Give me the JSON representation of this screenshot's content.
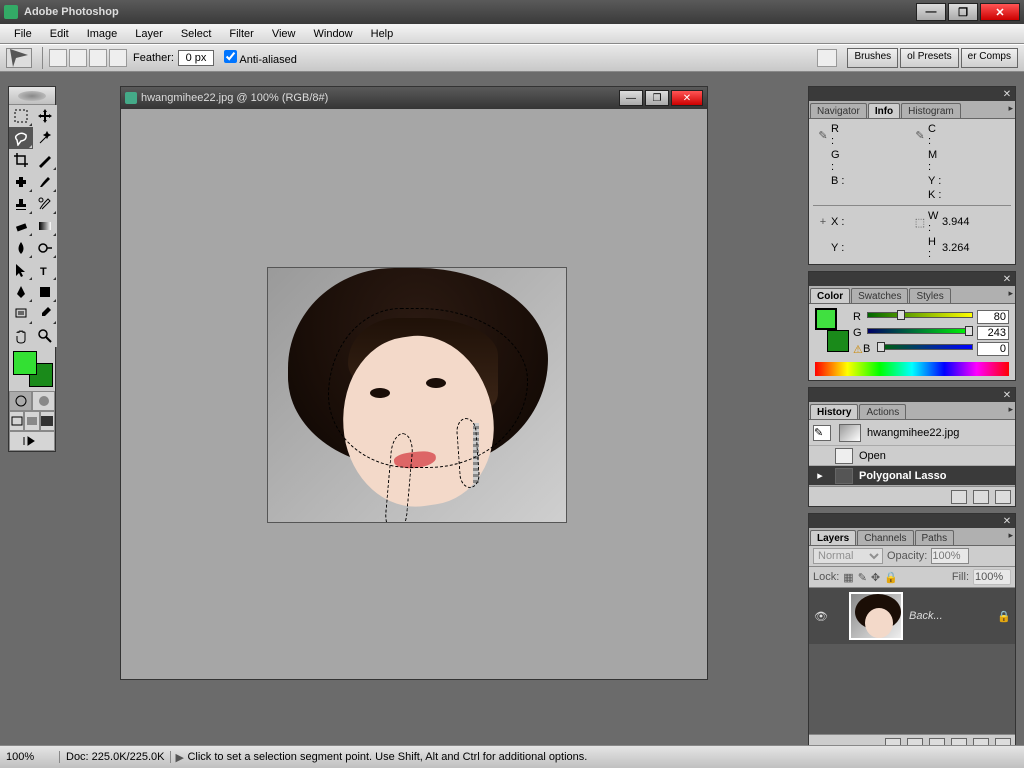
{
  "app": {
    "title": "Adobe Photoshop"
  },
  "menus": [
    "File",
    "Edit",
    "Image",
    "Layer",
    "Select",
    "Filter",
    "View",
    "Window",
    "Help"
  ],
  "options": {
    "feather_label": "Feather:",
    "feather_value": "0 px",
    "antialias_label": "Anti-aliased",
    "antialias_checked": true,
    "tabs": [
      "Brushes",
      "ol Presets",
      "er Comps"
    ]
  },
  "document": {
    "title": "hwangmihee22.jpg @ 100% (RGB/8#)"
  },
  "info_panel": {
    "tabs": [
      "Navigator",
      "Info",
      "Histogram"
    ],
    "active": 1,
    "rgb": {
      "R": "R :",
      "G": "G :",
      "B": "B :",
      "Rv": "",
      "Gv": "",
      "Bv": ""
    },
    "cmyk": {
      "C": "C :",
      "M": "M :",
      "Y": "Y :",
      "K": "K :"
    },
    "xy": {
      "X": "X :",
      "Y": "Y :",
      "Xv": "",
      "Yv": ""
    },
    "wh": {
      "W": "W :",
      "H": "H :",
      "Wv": "3.944",
      "Hv": "3.264"
    }
  },
  "color_panel": {
    "tabs": [
      "Color",
      "Swatches",
      "Styles"
    ],
    "active": 0,
    "fg": "#33cc33",
    "bg": "#1a8a1a",
    "R": {
      "label": "R",
      "value": "80"
    },
    "G": {
      "label": "G",
      "value": "243"
    },
    "B": {
      "label": "B",
      "value": "0"
    }
  },
  "history_panel": {
    "tabs": [
      "History",
      "Actions"
    ],
    "active": 0,
    "snapshot": "hwangmihee22.jpg",
    "states": [
      "Open",
      "Polygonal Lasso"
    ],
    "active_state": 1
  },
  "layers_panel": {
    "tabs": [
      "Layers",
      "Channels",
      "Paths"
    ],
    "active": 0,
    "blend_mode": "Normal",
    "opacity_label": "Opacity:",
    "opacity_value": "100%",
    "lock_label": "Lock:",
    "fill_label": "Fill:",
    "fill_value": "100%",
    "layer_name": "Back..."
  },
  "status": {
    "zoom": "100%",
    "doc": "Doc: 225.0K/225.0K",
    "hint": "Click to set a selection segment point.  Use Shift, Alt and Ctrl for additional options."
  }
}
